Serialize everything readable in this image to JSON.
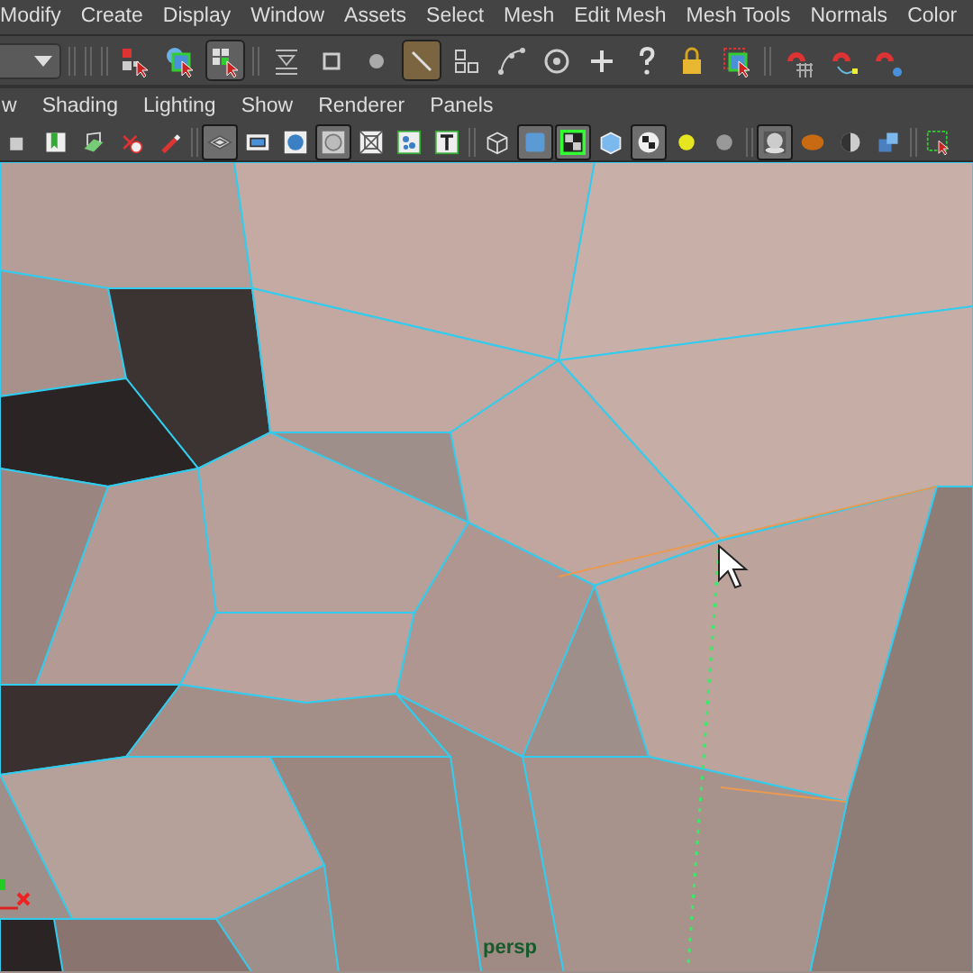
{
  "menu_bar": [
    "Modify",
    "Create",
    "Display",
    "Window",
    "Assets",
    "Select",
    "Mesh",
    "Edit Mesh",
    "Mesh Tools",
    "Normals",
    "Color"
  ],
  "status_toolbar": {
    "tools": [
      {
        "selected": false
      },
      {
        "selected": false
      },
      {
        "selected": true
      },
      {
        "selected": false
      },
      {
        "selected": false
      },
      {
        "selected": false
      },
      {
        "selected": true
      },
      {
        "selected": false
      },
      {
        "selected": false
      },
      {
        "selected": false
      },
      {
        "selected": false
      },
      {
        "selected": false
      },
      {
        "selected": false
      },
      {
        "selected": false
      },
      {
        "selected": false
      },
      {
        "selected": false
      },
      {
        "selected": false
      }
    ]
  },
  "panel_menu": [
    "w",
    "Shading",
    "Lighting",
    "Show",
    "Renderer",
    "Panels"
  ],
  "panel_toolbar": {
    "tools": [
      {
        "selected": false
      },
      {
        "selected": false
      },
      {
        "selected": false
      },
      {
        "selected": false
      },
      {
        "selected": false
      },
      {
        "selected": true
      },
      {
        "selected": false
      },
      {
        "selected": false
      },
      {
        "selected": true
      },
      {
        "selected": false
      },
      {
        "selected": false
      },
      {
        "selected": false
      },
      {
        "selected": false
      },
      {
        "selected": true
      },
      {
        "selected": true
      },
      {
        "selected": false
      },
      {
        "selected": true
      },
      {
        "selected": false
      },
      {
        "selected": false
      },
      {
        "selected": true
      },
      {
        "selected": false
      },
      {
        "selected": false
      },
      {
        "selected": false
      },
      {
        "selected": false
      }
    ]
  },
  "viewport": {
    "camera_label": "persp"
  }
}
